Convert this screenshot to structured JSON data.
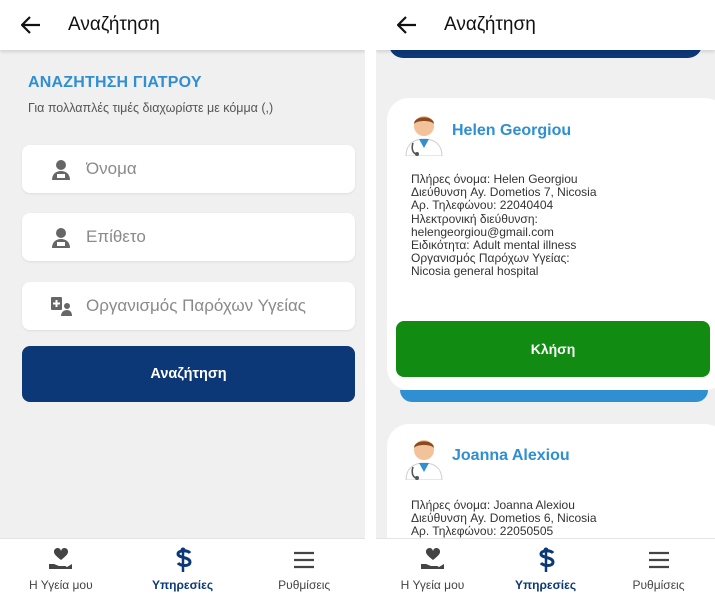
{
  "search_screen": {
    "appbar_title": "Αναζήτηση",
    "heading": "ΑΝΑΖΗΤΗΣΗ ΓΙΑΤΡΟΥ",
    "hint": "Για πολλαπλές τιμές διαχωρίστε με κόμμα (,)",
    "fields": {
      "first_name_placeholder": "Όνομα",
      "last_name_placeholder": "Επίθετο",
      "provider_placeholder": "Οργανισμός Παρόχων Υγείας"
    },
    "search_button": "Αναζήτηση"
  },
  "results_screen": {
    "appbar_title": "Αναζήτηση",
    "doctors": [
      {
        "name": "Helen Georgiou",
        "lines": [
          "Πλήρες όνομα:  Helen Georgiou",
          "Διεύθυνση  Ay. Dometios 7, Nicosia",
          "Αρ. Τηλεφώνου:  22040404",
          "Ηλεκτρονική διεύθυνση:",
          "helengeorgiou@gmail.com",
          "Ειδικότητα:  Adult mental illness",
          "Οργανισμός Παρόχων Υγείας:",
          "Nicosia general hospital"
        ],
        "call_button": "Κλήση"
      },
      {
        "name": "Joanna Alexiou",
        "lines": [
          "Πλήρες όνομα:  Joanna Alexiou",
          "Διεύθυνση  Ay. Dometios 6, Nicosia",
          "Αρ. Τηλεφώνου:  22050505"
        ]
      }
    ]
  },
  "bottom_nav": {
    "items": [
      {
        "label": "Η Υγεία μου",
        "icon": "hand-heart-icon"
      },
      {
        "label": "Υπηρεσίες",
        "icon": "medical-services-icon",
        "active": true
      },
      {
        "label": "Ρυθμίσεις",
        "icon": "menu-icon"
      }
    ]
  },
  "colors": {
    "primary_dark": "#0c3878",
    "accent_blue": "#2f8fd1",
    "call_green": "#118b11",
    "background": "#f0f0f0"
  }
}
